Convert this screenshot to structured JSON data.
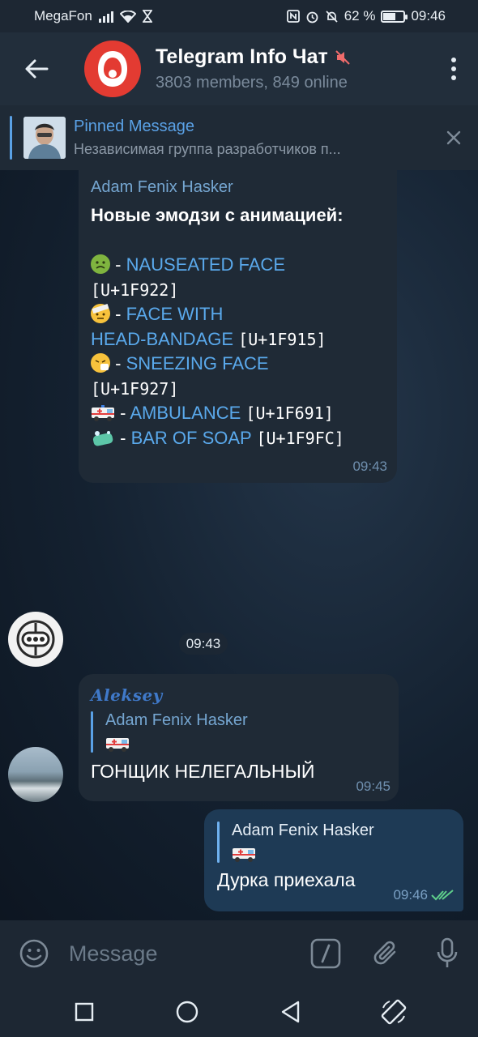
{
  "status_bar": {
    "carrier": "MegaFon",
    "battery_percent": "62 %",
    "battery_level": 0.62,
    "time": "09:46"
  },
  "header": {
    "title": "Telegram Info Чат",
    "subtitle": "3803 members, 849 online",
    "muted": true
  },
  "pinned": {
    "title": "Pinned Message",
    "text": "Независимая группа разработчиков п..."
  },
  "messages": [
    {
      "sender": "Adam Fenix Hasker",
      "heading": "Новые эмодзи с анимацией:",
      "lines": [
        {
          "emoji": "nauseated-face",
          "name": "NAUSEATED FACE",
          "code": "[U+1F922]"
        },
        {
          "emoji": "face-with-head-bandage",
          "name_1": "FACE WITH",
          "name_2": "HEAD-BANDAGE",
          "code": "[U+1F915]"
        },
        {
          "emoji": "sneezing-face",
          "name": "SNEEZING FACE",
          "code": "[U+1F927]"
        },
        {
          "emoji": "ambulance",
          "name": "AMBULANCE",
          "code": "[U+1F691]"
        },
        {
          "emoji": "bar-of-soap",
          "name": "BAR OF SOAP",
          "code": "[U+1F9FC]"
        }
      ],
      "dash": "-",
      "time": "09:43"
    },
    {
      "type": "service-time",
      "time": "09:43"
    },
    {
      "sender": "Aleksey",
      "reply_to": "Adam Fenix Hasker",
      "text": "ГОНЩИК НЕЛЕГАЛЬНЫЙ",
      "time": "09:45"
    },
    {
      "outgoing": true,
      "reply_to": "Adam Fenix Hasker",
      "text": "Дурка приехала",
      "time": "09:46",
      "read": true
    }
  ],
  "input": {
    "placeholder": "Message"
  },
  "colors": {
    "accent": "#5aa1e6",
    "link": "#5aa9ec",
    "header_bg": "#222e3b",
    "bubble_in": "#1f2a36",
    "bubble_out": "#1e3a55",
    "avatar_red": "#e33b32",
    "read_check": "#5fcf8b"
  }
}
